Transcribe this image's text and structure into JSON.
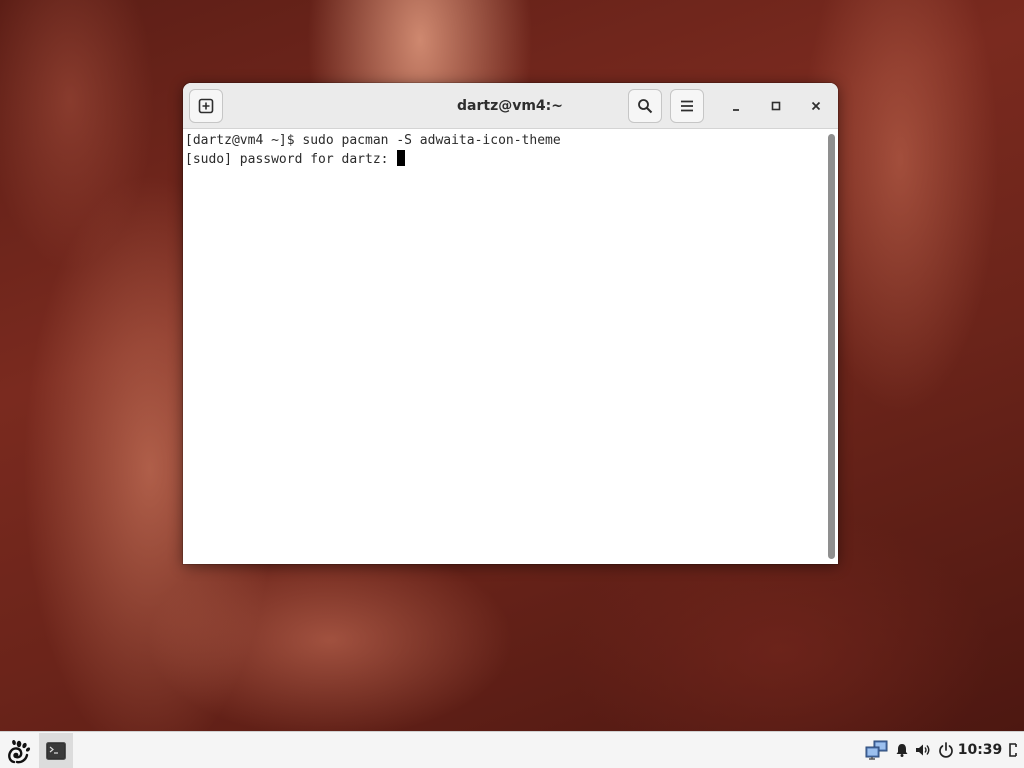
{
  "window": {
    "title": "dartz@vm4:~"
  },
  "terminal": {
    "line1": "[dartz@vm4 ~]$ sudo pacman -S adwaita-icon-theme",
    "line2": "[sudo] password for dartz: "
  },
  "icons": {
    "new_tab": "new-tab-icon",
    "search": "search-icon",
    "menu": "hamburger-menu-icon",
    "minimize": "minimize-icon",
    "maximize": "maximize-icon",
    "close": "close-icon",
    "activities": "gnome-foot-icon",
    "terminal_task": "terminal-icon",
    "network": "network-icon",
    "notifications": "bell-icon",
    "volume": "speaker-icon",
    "power": "power-icon",
    "logout": "logout-icon"
  },
  "taskbar": {
    "clock": "10:39"
  },
  "colors": {
    "headerbar": "#ebebeb",
    "terminal_bg": "#ffffff",
    "terminal_text": "#2b2b2b",
    "taskbar": "#f5f5f5"
  }
}
